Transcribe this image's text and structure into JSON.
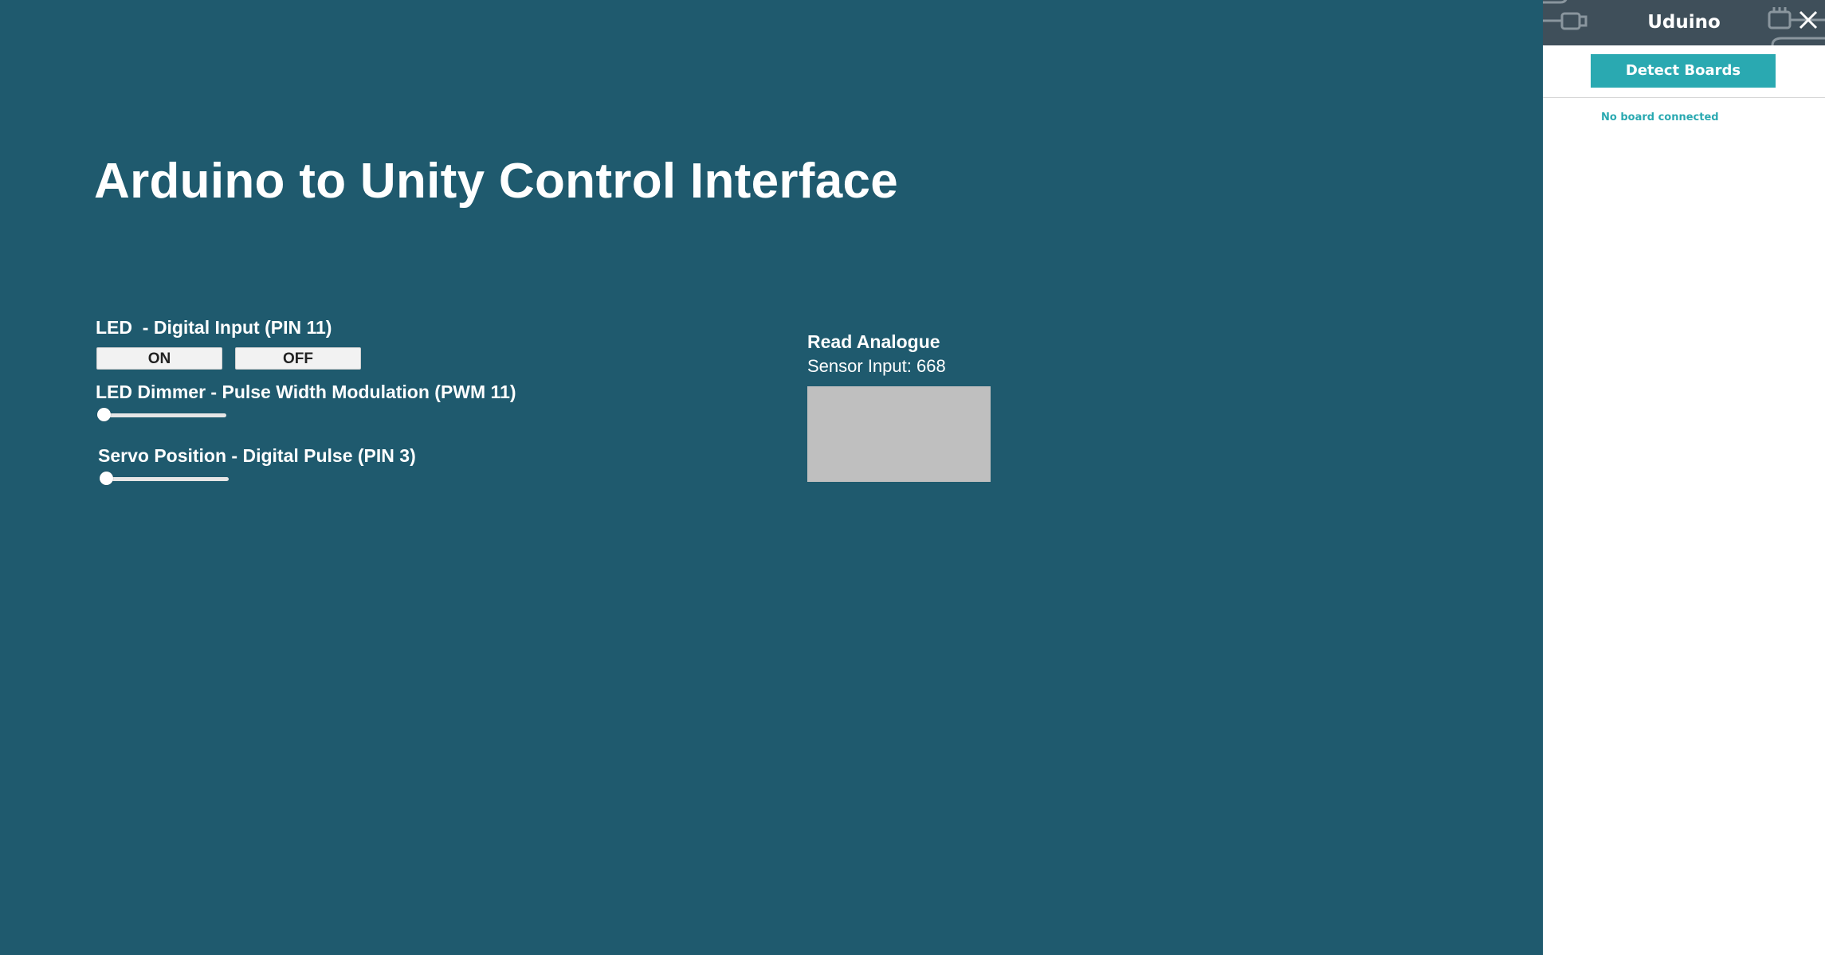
{
  "main": {
    "title": "Arduino to Unity Control Interface",
    "led": {
      "label": "LED  - Digital Input (PIN 11)",
      "on_label": "ON",
      "off_label": "OFF"
    },
    "dimmer": {
      "label": "LED Dimmer - Pulse Width Modulation (PWM 11)",
      "value": 0
    },
    "servo": {
      "label": "Servo Position - Digital Pulse (PIN 3)",
      "value": 0
    },
    "analogue": {
      "heading": "Read Analogue",
      "sensor_text": "Sensor Input: 668"
    }
  },
  "panel": {
    "title": "Uduino",
    "detect_label": "Detect Boards",
    "status": "No board connected",
    "icons": [
      "plug-icon",
      "chip-icon",
      "close-icon"
    ]
  },
  "colors": {
    "background": "#1f5a6e",
    "panel_header": "#3f4f5a",
    "accent": "#2aa9b1",
    "sensor_box": "#bfbfbf"
  }
}
